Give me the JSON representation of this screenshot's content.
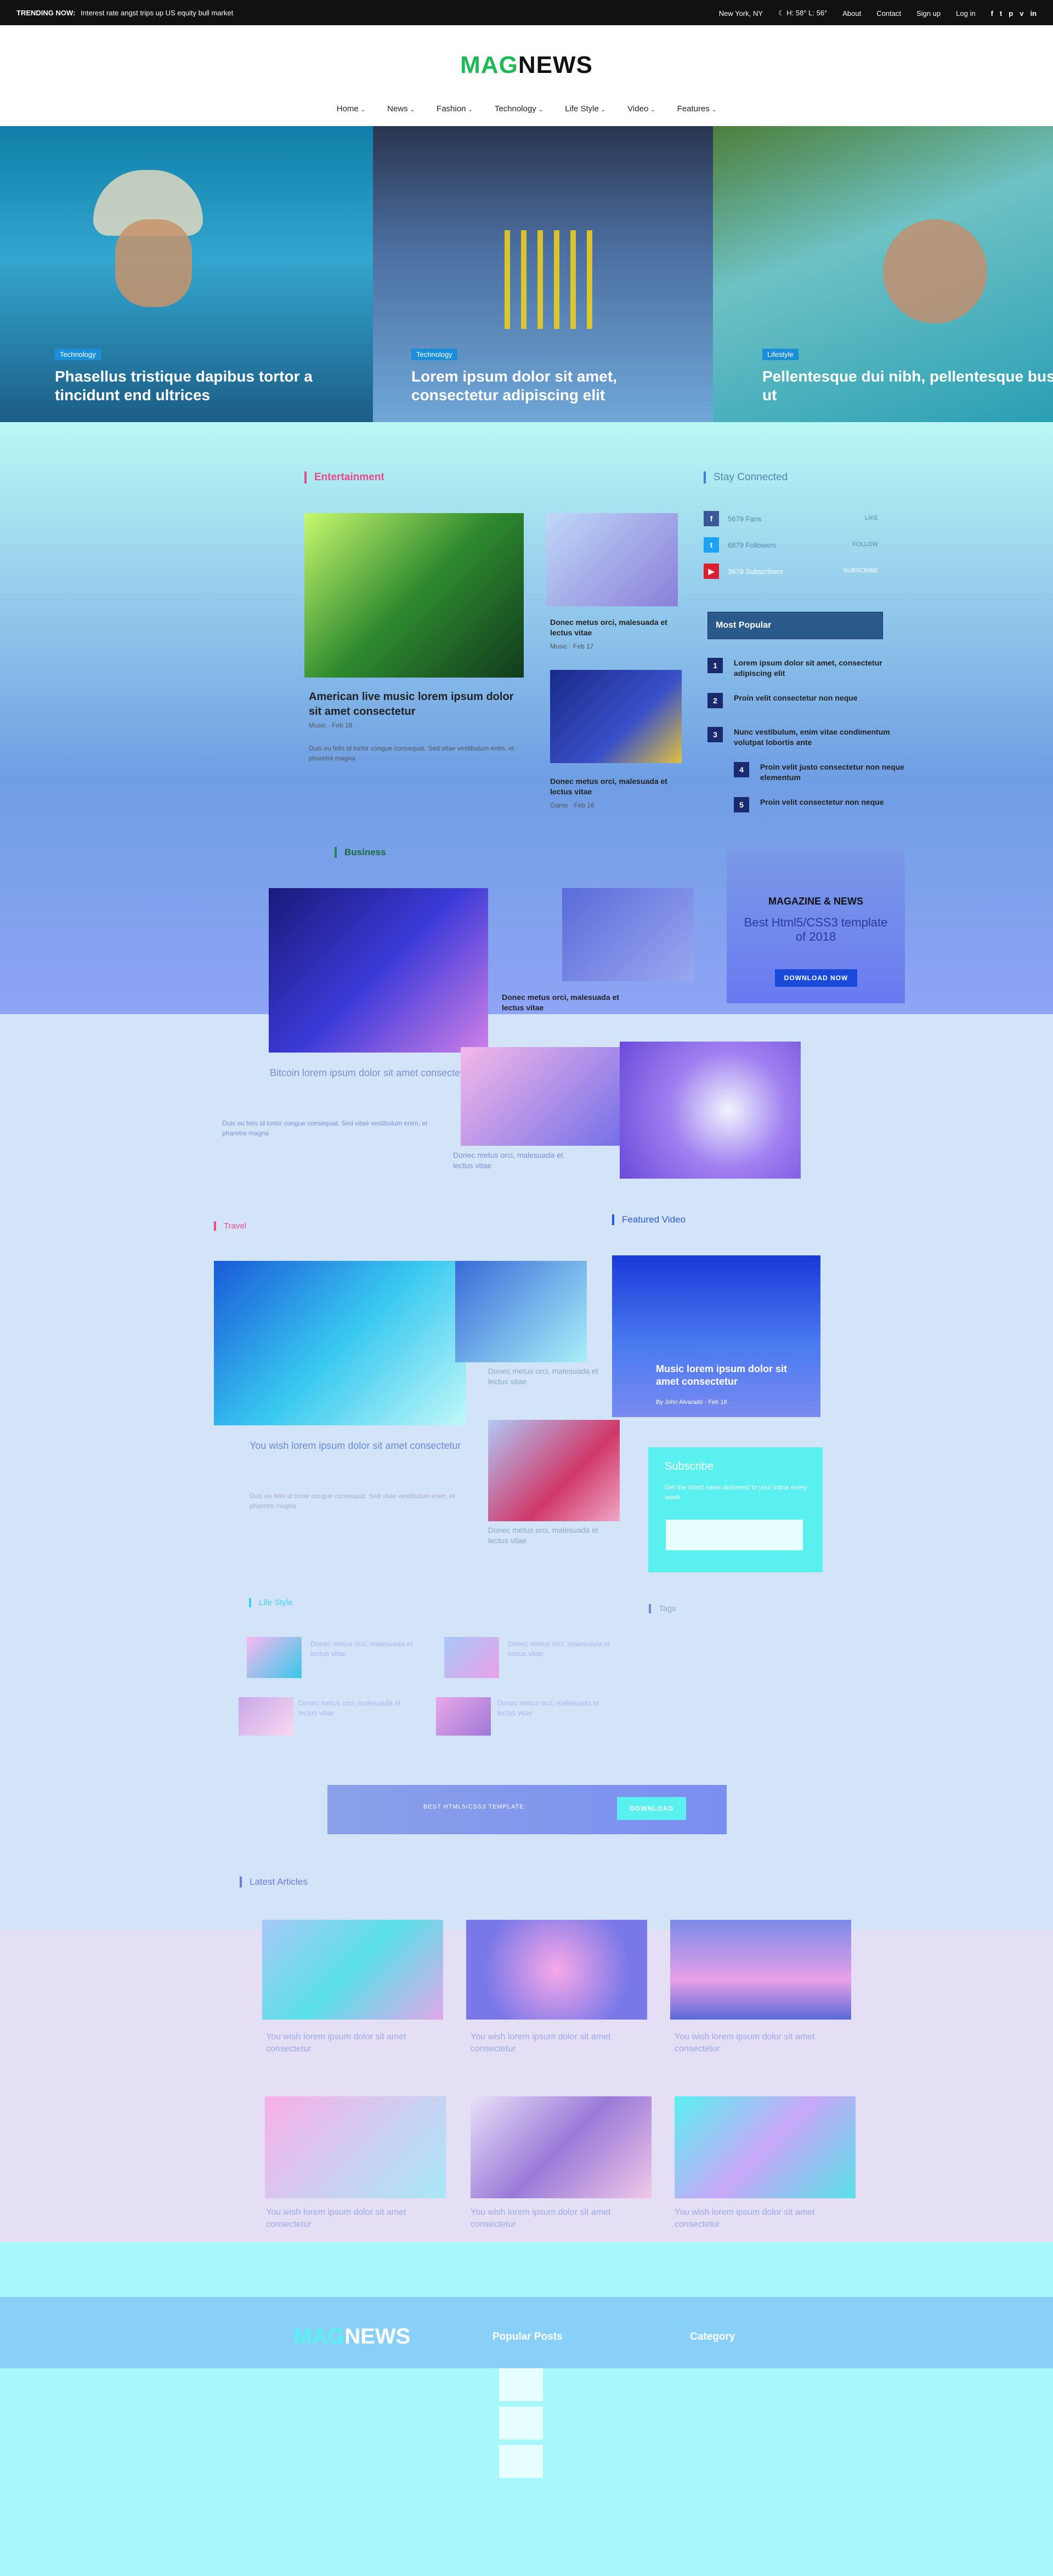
{
  "topbar": {
    "trending_label": "TRENDING NOW:",
    "trending_headline": "Interest rate angst trips up US equity bull market",
    "location": "New York, NY",
    "weather": "H: 58° L: 56°",
    "links": [
      "About",
      "Contact",
      "Sign up",
      "Log in"
    ],
    "social": [
      "f",
      "t",
      "p",
      "v",
      "in"
    ]
  },
  "header": {
    "logo_part1": "MAG",
    "logo_part2": "NEWS",
    "nav": [
      "Home",
      "News",
      "Fashion",
      "Technology",
      "Life Style",
      "Video",
      "Features"
    ]
  },
  "hero": {
    "slides": [
      {
        "tag": "Technology",
        "title": "Phasellus tristique dapibus tortor a tincidunt end ultrices"
      },
      {
        "tag": "Technology",
        "title": "Lorem ipsum dolor sit amet, consectetur adipiscing elit"
      },
      {
        "tag": "Lifestyle",
        "title": "Pellentesque dui nibh, pellentesque bus ut"
      }
    ]
  },
  "entertainment": {
    "heading": "Entertainment",
    "main_title": "American live music lorem ipsum dolor sit amet consectetur",
    "main_meta": "Music · Feb 18",
    "main_excerpt": "Duis eu felis id tortor congue consequat. Sed vitae vestibulum enim, et pharetra magna",
    "side": [
      {
        "title": "Donec metus orci, malesuada et lectus vitae",
        "meta": "Music · Feb 17"
      },
      {
        "title": "Donec metus orci, malesuada et lectus vitae",
        "meta": "Game · Feb 16"
      }
    ]
  },
  "stay_connected": {
    "heading": "Stay Connected",
    "items": [
      {
        "label": "5679 Fans",
        "action": "LIKE"
      },
      {
        "label": "6879 Followers",
        "action": "FOLLOW"
      },
      {
        "label": "3679 Subscribers",
        "action": "SUBSCRIBE"
      }
    ]
  },
  "most_popular": {
    "heading": "Most Popular",
    "items": [
      {
        "n": "1",
        "title": "Lorem ipsum dolor sit amet, consectetur adipiscing elit"
      },
      {
        "n": "2",
        "title": "Proin velit consectetur non neque"
      },
      {
        "n": "3",
        "title": "Nunc vestibulum, enim vitae condimentum volutpat lobortis ante"
      },
      {
        "n": "4",
        "title": "Proin velit justo consectetur non neque elementum"
      },
      {
        "n": "5",
        "title": "Proin velit consectetur non neque"
      }
    ]
  },
  "business": {
    "heading": "Business",
    "main_title": "Bitcoin lorem ipsum dolor sit amet consectetur",
    "main_excerpt": "Duis eu felis id tortor congue consequat. Sed vitae vestibulum enim, et pharetra magna",
    "side": [
      {
        "title": "Donec metus orci, malesuada et lectus vitae"
      },
      {
        "title": "Donec metus orci, malesuada et lectus vitae"
      }
    ]
  },
  "sidebar_ad": {
    "title": "MAGAZINE & NEWS",
    "subtitle": "Best Html5/CSS3 template of 2018",
    "button": "DOWNLOAD NOW"
  },
  "travel": {
    "heading": "Travel",
    "main_title": "You wish lorem ipsum dolor sit amet consectetur",
    "main_excerpt": "Duis eu felis id tortor congue consequat. Sed vitae vestibulum enim, et pharetra magna",
    "side": [
      {
        "title": "Donec metus orci, malesuada et lectus vitae"
      },
      {
        "title": "Donec metus orci, malesuada et lectus vitae"
      }
    ]
  },
  "featured_video": {
    "heading": "Featured Video",
    "title": "Music lorem ipsum dolor sit amet consectetur",
    "meta": "By John Alvarado · Feb 18"
  },
  "subscribe": {
    "heading": "Subscribe",
    "text": "Get the latest news delivered to your inbox every week",
    "placeholder": ""
  },
  "lifestyle": {
    "heading": "Life Style",
    "items": [
      {
        "title": "Donec metus orci, malesuada et lectus vitae"
      },
      {
        "title": "Donec metus orci, malesuada et lectus vitae"
      },
      {
        "title": "Donec metus orci, malesuada et lectus vitae"
      },
      {
        "title": "Donec metus orci, malesuada et lectus vitae"
      }
    ]
  },
  "tags": {
    "heading": "Tags"
  },
  "banner": {
    "text": "BEST HTML5/CSS3 TEMPLATE",
    "button": "DOWNLOAD"
  },
  "latest": {
    "heading": "Latest Articles",
    "items": [
      {
        "title": "You wish lorem ipsum dolor sit amet consectetur"
      },
      {
        "title": "You wish lorem ipsum dolor sit amet consectetur"
      },
      {
        "title": "You wish lorem ipsum dolor sit amet consectetur"
      },
      {
        "title": "You wish lorem ipsum dolor sit amet consectetur"
      },
      {
        "title": "You wish lorem ipsum dolor sit amet consectetur"
      },
      {
        "title": "You wish lorem ipsum dolor sit amet consectetur"
      }
    ]
  },
  "footer": {
    "logo_part1": "MAG",
    "logo_part2": "NEWS",
    "popular_heading": "Popular Posts",
    "category_heading": "Category"
  },
  "colors": {
    "accent_green": "#1db954",
    "tag_blue": "#1a8ed8",
    "popular_num": "#1a2a6e"
  }
}
